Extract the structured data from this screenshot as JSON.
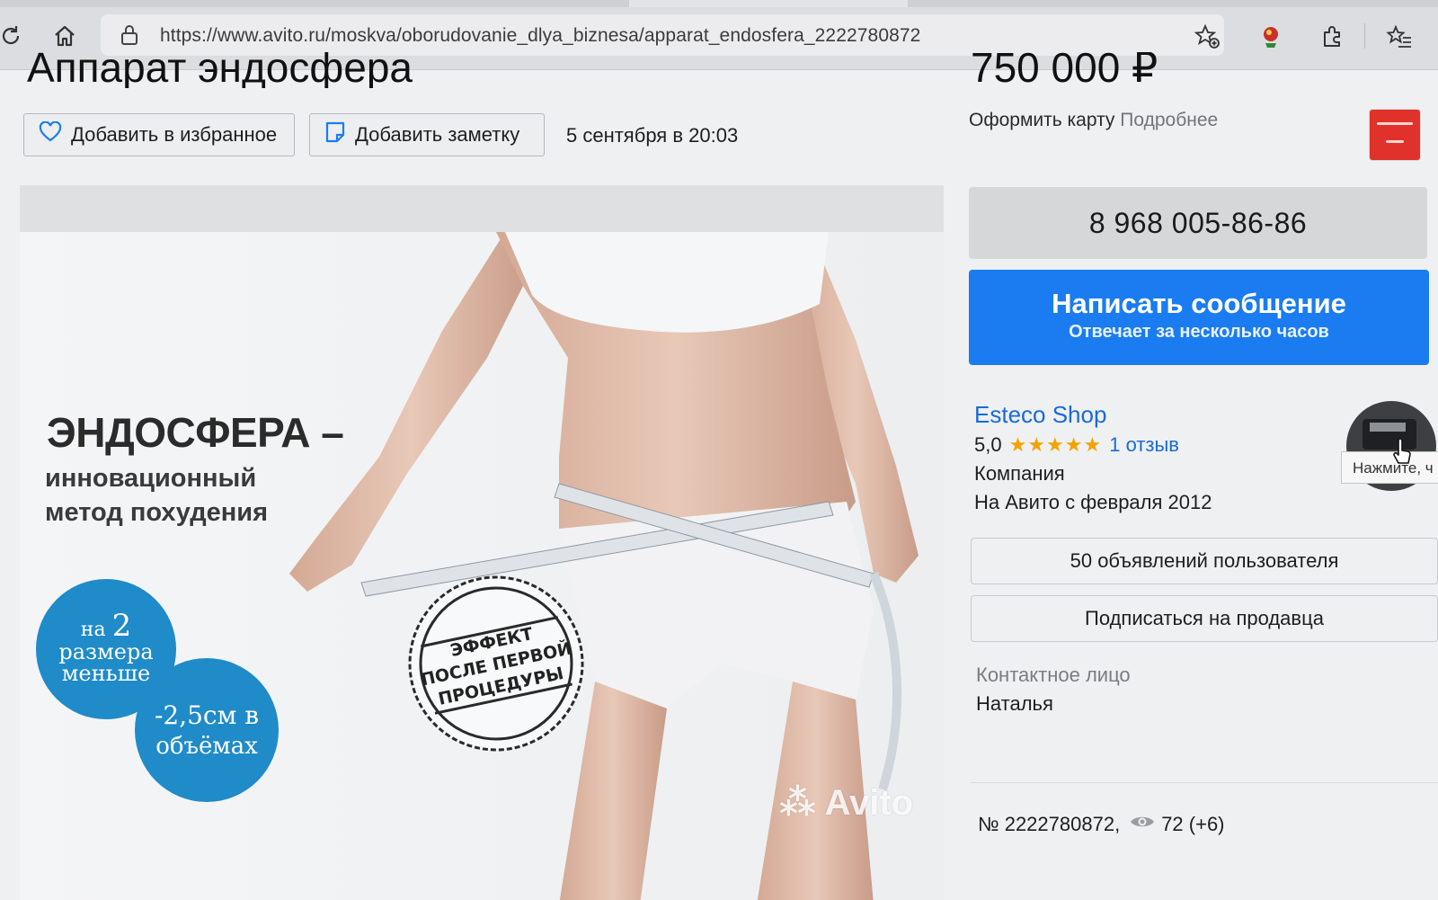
{
  "browser": {
    "url": "https://www.avito.ru/moskva/oborudovanie_dlya_biznesa/apparat_endosfera_2222780872"
  },
  "listing": {
    "title": "Аппарат эндосфера",
    "price": "750 000 ₽",
    "add_favorite_label": "Добавить в избранное",
    "add_note_label": "Добавить заметку",
    "date": "5 сентября в 20:03",
    "card_offer": "Оформить карту",
    "card_more": "Подробнее",
    "id_text": "№ 2222780872,",
    "views": "72 (+6)"
  },
  "hero": {
    "headline": "ЭНДОСФЕРА –",
    "sub_line1": "инновационный",
    "sub_line2": "метод похудения",
    "badge1_line1": "на",
    "badge1_num": "2",
    "badge1_line2": "размера",
    "badge1_line3": "меньше",
    "badge2_line1": "-2,5см в",
    "badge2_line2": "объёмах",
    "stamp_line1": "ЭФФЕКТ",
    "stamp_line2": "ПОСЛЕ ПЕРВОЙ",
    "stamp_line3": "ПРОЦЕДУРЫ",
    "watermark": "Avito"
  },
  "contact": {
    "phone": "8 968 005-86-86",
    "message_label": "Написать сообщение",
    "message_sub": "Отвечает за несколько часов",
    "seller_name": "Esteco Shop",
    "rating": "5,0",
    "stars": "★★★★★",
    "reviews": "1 отзыв",
    "seller_type": "Компания",
    "since": "На Авито с февраля 2012",
    "tooltip": "Нажмите, ч",
    "listings_button": "50 объявлений пользователя",
    "subscribe_button": "Подписаться на продавца",
    "contact_person_label": "Контактное лицо",
    "contact_person_name": "Наталья"
  },
  "colors": {
    "accent_blue": "#1a7cf0",
    "link_blue": "#1a6ad8",
    "star": "#f4a300",
    "badge_blue": "#1f8bc8",
    "bank_red": "#e0322a"
  }
}
